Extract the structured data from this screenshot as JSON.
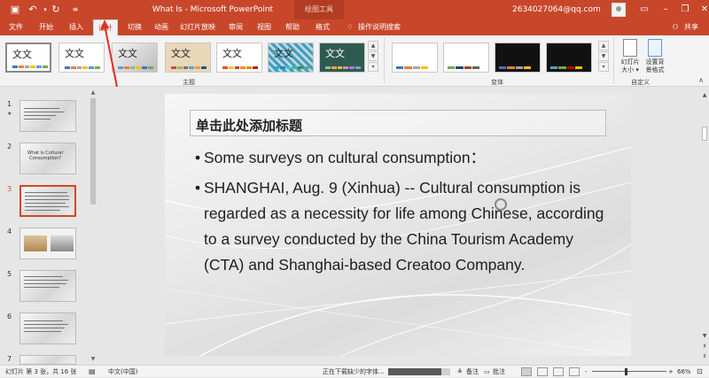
{
  "titlebar": {
    "title": "What Is  -  Microsoft PowerPoint",
    "tool_context": "绘图工具",
    "user": "2634027064@qq.com",
    "save_icon": "save-icon",
    "undo_icon": "undo-icon",
    "redo_icon": "redo-icon",
    "customize_icon": "customize-icon"
  },
  "tabs": [
    "文件",
    "开始",
    "插入",
    "设计",
    "切换",
    "动画",
    "幻灯片放映",
    "审阅",
    "视图",
    "帮助",
    "格式"
  ],
  "active_tab": "设计",
  "tell_me": "操作说明搜索",
  "share": "共享",
  "ribbon": {
    "themes_label": "主题",
    "variants_label": "变体",
    "customize_label": "自定义",
    "theme_text": "文文",
    "theme_text_alt": "文文",
    "slide_size": "幻灯片\n大小 ▾",
    "format_bg": "设置背\n景格式"
  },
  "slides": {
    "count_label": "幻灯片 第 3 张，共 16 张",
    "numbers": [
      "1",
      "2",
      "3",
      "4",
      "5",
      "6",
      "7"
    ],
    "star": "★",
    "thumb2_text": "What is Cultural Consumption?"
  },
  "slide": {
    "title": "单击此处添加标题",
    "bullets": [
      "Some surveys on cultural consumption：",
      "SHANGHAI, Aug. 9 (Xinhua) -- Cultural consumption is regarded as a necessity for life among Chinese, according to a survey conducted by the China Tourism Academy (CTA) and Shanghai-based Creatoo Company."
    ],
    "bullet_char": "•"
  },
  "statusbar": {
    "language": "中文(中国)",
    "download_status": "正在下载缺少的字体...",
    "download_progress": 0.85,
    "notes": "备注",
    "comments": "批注",
    "zoom": "66%",
    "zoom_minus": "-",
    "zoom_plus": "+",
    "zoom_level": 0.66
  },
  "colors": {
    "accent": "#c8472b",
    "ribbon_bg": "#f3f3f3"
  }
}
